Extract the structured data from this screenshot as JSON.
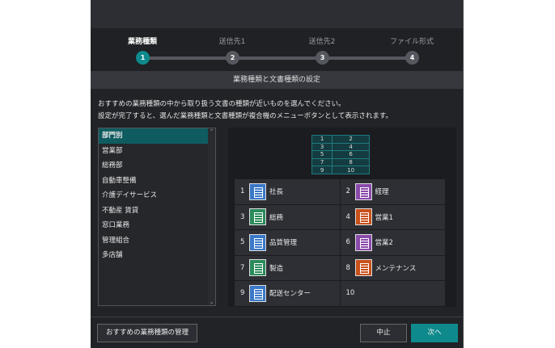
{
  "steps": [
    "業務種類",
    "送信先1",
    "送信先2",
    "ファイル形式"
  ],
  "step_numbers": [
    "1",
    "2",
    "3",
    "4"
  ],
  "section_title": "業務種類と文書種類の設定",
  "description": [
    "おすすめの業務種類の中から取り扱う文書の種類が近いものを選んでください。",
    "設定が完了すると、選んだ業務種類と文書種類が複合機のメニューボタンとして表示されます。"
  ],
  "business_types": [
    "部門別",
    "営業部",
    "総務部",
    "自動車整備",
    "介護デイサービス",
    "不動産 賃貸",
    "窓口業務",
    "管理組合",
    "多店舗"
  ],
  "selected_business_type": "部門別",
  "layout_preview": [
    [
      "1",
      "2"
    ],
    [
      "3",
      "4"
    ],
    [
      "5",
      "6"
    ],
    [
      "7",
      "8"
    ],
    [
      "9",
      "10"
    ]
  ],
  "document_buttons": [
    {
      "num": "1",
      "label": "社長",
      "color": "#3a78c8"
    },
    {
      "num": "2",
      "label": "経理",
      "color": "#8a4aaa"
    },
    {
      "num": "3",
      "label": "総務",
      "color": "#2a8a5a"
    },
    {
      "num": "4",
      "label": "営業1",
      "color": "#c8501a"
    },
    {
      "num": "5",
      "label": "品質管理",
      "color": "#3a78c8"
    },
    {
      "num": "6",
      "label": "営業2",
      "color": "#8a4aaa"
    },
    {
      "num": "7",
      "label": "製造",
      "color": "#2a8a5a"
    },
    {
      "num": "8",
      "label": "メンテナンス",
      "color": "#c8501a"
    },
    {
      "num": "9",
      "label": "配送センター",
      "color": "#3a78c8"
    },
    {
      "num": "10",
      "label": "",
      "color": ""
    }
  ],
  "footer": {
    "manage_label": "おすすめの業務種類の管理",
    "cancel_label": "中止",
    "next_label": "次へ"
  },
  "accent": "#0e8a8c"
}
